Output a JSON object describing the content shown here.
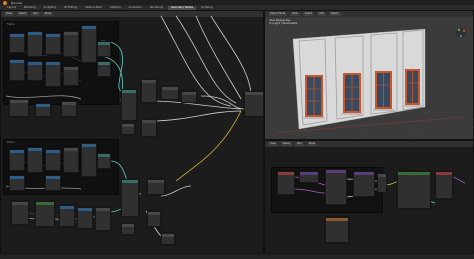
{
  "app": {
    "title": "Blender"
  },
  "workspaces": [
    {
      "label": "Layout"
    },
    {
      "label": "Modeling"
    },
    {
      "label": "Sculpting"
    },
    {
      "label": "UV Editing"
    },
    {
      "label": "Texture Paint"
    },
    {
      "label": "Shading"
    },
    {
      "label": "Animation"
    },
    {
      "label": "Rendering"
    },
    {
      "label": "Geometry Nodes"
    },
    {
      "label": "Scripting"
    }
  ],
  "left_editor": {
    "header_chips": [
      {
        "label": "View"
      },
      {
        "label": "Select"
      },
      {
        "label": "Add"
      },
      {
        "label": "Node"
      }
    ],
    "frames": [
      {
        "label": "Frame"
      },
      {
        "label": "Frame"
      }
    ]
  },
  "viewport": {
    "header_chips": [
      {
        "label": "Object Mode"
      },
      {
        "label": "View"
      },
      {
        "label": "Select"
      },
      {
        "label": "Add"
      },
      {
        "label": "Object"
      }
    ],
    "overlay_line1": "User Perspective",
    "overlay_line2": "(1) Light | Windows01"
  },
  "bottom_right_editor": {
    "header_chips": [
      {
        "label": "View"
      },
      {
        "label": "Select"
      },
      {
        "label": "Add"
      },
      {
        "label": "Node"
      }
    ]
  },
  "colors": {
    "wall": "#d9d9d9",
    "window_frame": "#c8562a",
    "window_glass": "#3a4a5e",
    "accent": "#e87d0d"
  }
}
